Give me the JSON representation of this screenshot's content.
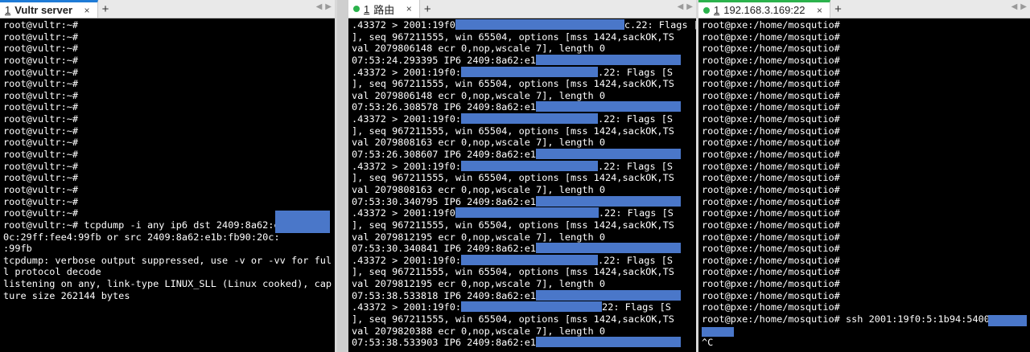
{
  "panes": [
    {
      "tab": {
        "index": "1",
        "title": "Vultr server",
        "close": "×",
        "add": "+"
      },
      "lines": [
        "root@vultr:~#",
        "root@vultr:~#",
        "root@vultr:~#",
        "root@vultr:~#",
        "root@vultr:~#",
        "root@vultr:~#",
        "root@vultr:~#",
        "root@vultr:~#",
        "root@vultr:~#",
        "root@vultr:~#",
        "root@vultr:~#",
        "root@vultr:~#",
        "root@vultr:~#",
        "root@vultr:~#",
        "root@vultr:~#",
        "root@vultr:~#",
        "root@vultr:~#",
        "root@vultr:~# tcpdump -i any ip6 dst 2409:8a62:e",
        "0c:29ff:fee4:99fb or src 2409:8a62:e1b:fb90:20c:",
        ":99fb",
        "tcpdump: verbose output suppressed, use -v or -vv for ful",
        "l protocol decode",
        "listening on any, link-type LINUX_SLL (Linux cooked), cap",
        "ture size 262144 bytes"
      ]
    },
    {
      "tab": {
        "index": "1",
        "title": "路由",
        "close": "×",
        "add": "+"
      },
      "lines": [
        ".43372 > 2001:19f0",
        "], seq 967211555, win 65504, options [mss 1424,sackOK,TS",
        "val 2079806148 ecr 0,nop,wscale 7], length 0",
        "07:53:24.293395 IP6 2409:8a62:e1",
        ".43372 > 2001:19f0:",
        "], seq 967211555, win 65504, options [mss 1424,sackOK,TS",
        "val 2079806148 ecr 0,nop,wscale 7], length 0",
        "07:53:26.308578 IP6 2409:8a62:e1",
        ".43372 > 2001:19f0:",
        "], seq 967211555, win 65504, options [mss 1424,sackOK,TS",
        "val 2079808163 ecr 0,nop,wscale 7], length 0",
        "07:53:26.308607 IP6 2409:8a62:e1",
        ".43372 > 2001:19f0:",
        "], seq 967211555, win 65504, options [mss 1424,sackOK,TS",
        "val 2079808163 ecr 0,nop,wscale 7], length 0",
        "07:53:30.340795 IP6 2409:8a62:e1",
        ".43372 > 2001:19f0",
        "], seq 967211555, win 65504, options [mss 1424,sackOK,TS",
        "val 2079812195 ecr 0,nop,wscale 7], length 0",
        "07:53:30.340841 IP6 2409:8a62:e1",
        ".43372 > 2001:19f0:",
        "], seq 967211555, win 65504, options [mss 1424,sackOK,TS",
        "val 2079812195 ecr 0,nop,wscale 7], length 0",
        "07:53:38.533818 IP6 2409:8a62:e1",
        ".43372 > 2001:19f0:",
        "], seq 967211555, win 65504, options [mss 1424,sackOK,TS",
        "val 2079820388 ecr 0,nop,wscale 7], length 0",
        "07:53:38.533903 IP6 2409:8a62:e1"
      ],
      "suffixes": {
        "0": "c.22: Flags [S",
        "4": ".22: Flags [S",
        "8": ".22: Flags [S",
        "12": ".22: Flags [S",
        "16": ".22: Flags [S",
        "20": ".22: Flags [S",
        "24": "22: Flags [S"
      }
    },
    {
      "tab": {
        "index": "1",
        "title": "192.168.3.169:22",
        "close": "×",
        "add": "+"
      },
      "lines": [
        "root@pxe:/home/mosqutio#",
        "root@pxe:/home/mosqutio#",
        "root@pxe:/home/mosqutio#",
        "root@pxe:/home/mosqutio#",
        "root@pxe:/home/mosqutio#",
        "root@pxe:/home/mosqutio#",
        "root@pxe:/home/mosqutio#",
        "root@pxe:/home/mosqutio#",
        "root@pxe:/home/mosqutio#",
        "root@pxe:/home/mosqutio#",
        "root@pxe:/home/mosqutio#",
        "root@pxe:/home/mosqutio#",
        "root@pxe:/home/mosqutio#",
        "root@pxe:/home/mosqutio#",
        "root@pxe:/home/mosqutio#",
        "root@pxe:/home/mosqutio#",
        "root@pxe:/home/mosqutio#",
        "root@pxe:/home/mosqutio#",
        "root@pxe:/home/mosqutio#",
        "root@pxe:/home/mosqutio#",
        "root@pxe:/home/mosqutio#",
        "root@pxe:/home/mosqutio#",
        "root@pxe:/home/mosqutio#",
        "root@pxe:/home/mosqutio#",
        "root@pxe:/home/mosqutio#",
        "root@pxe:/home/mosqutio# ssh 2001:19f0:5:1b94:5400:",
        "",
        "^C"
      ]
    }
  ],
  "colors": {
    "redaction": "#4a77c9",
    "terminal_bg": "#000000",
    "tab_accent_blue": "#1e7bd6",
    "status_green": "#2bb24c"
  }
}
